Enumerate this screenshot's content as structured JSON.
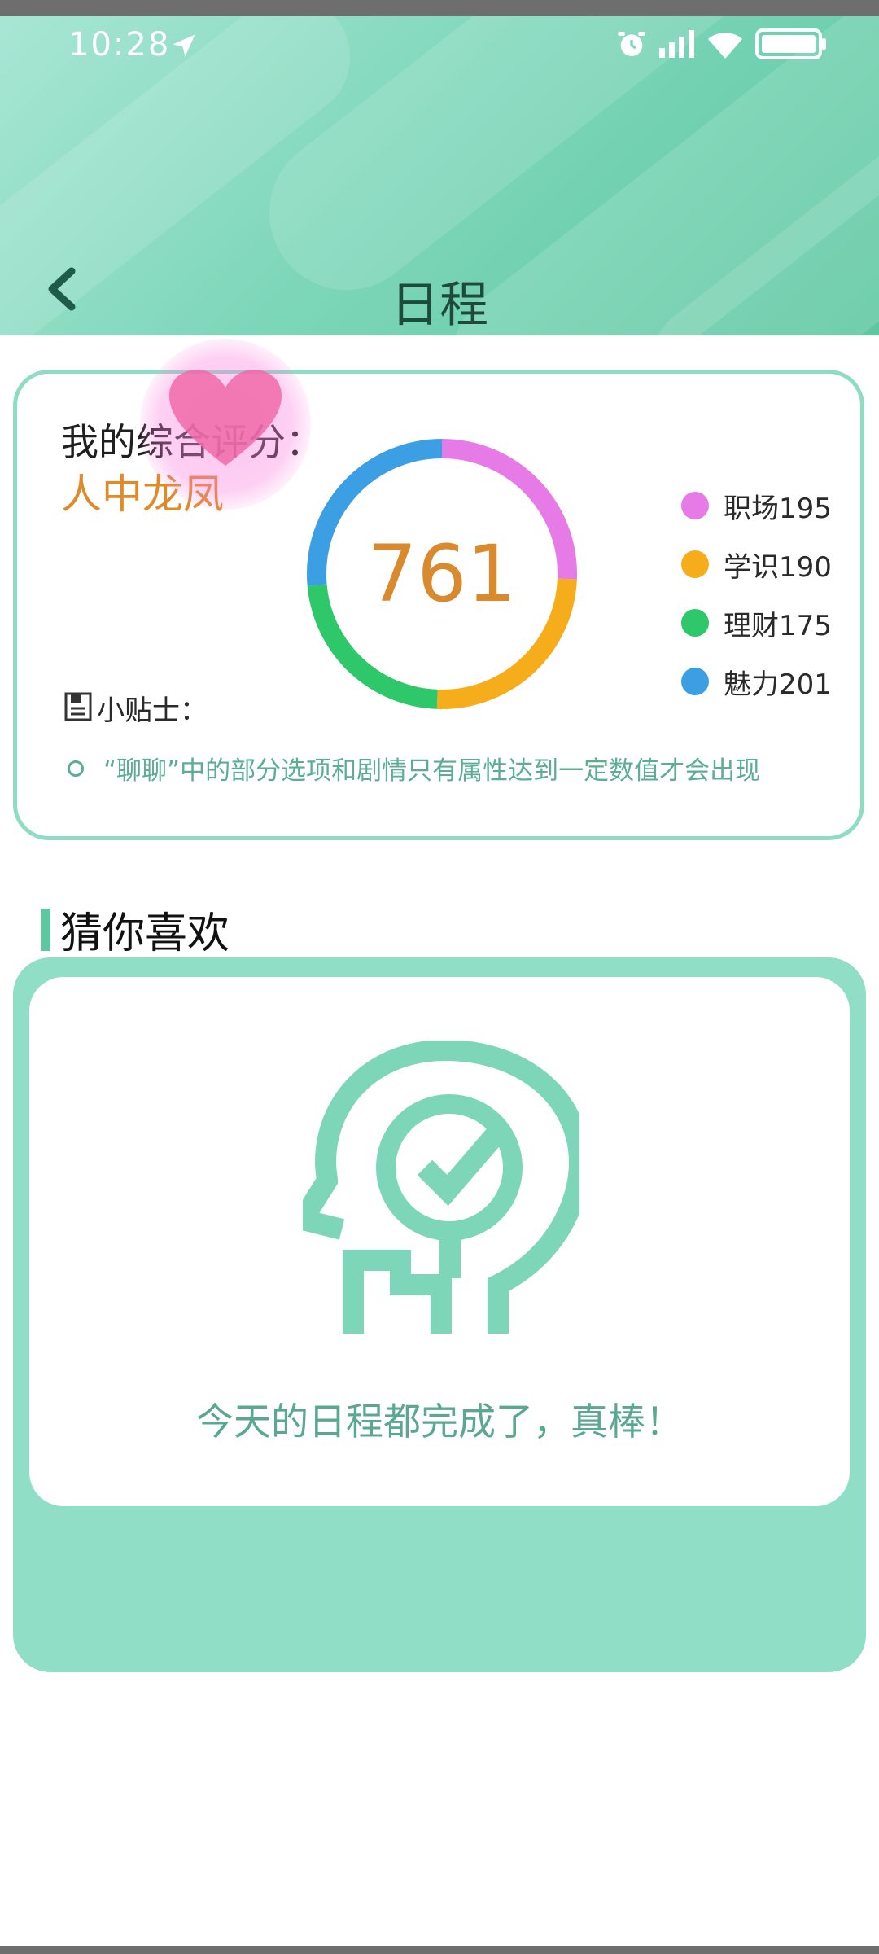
{
  "status_bar": {
    "time": "10:28"
  },
  "header": {
    "title": "日程"
  },
  "score_card": {
    "label": "我的综合评分：",
    "rank": "人中龙凤",
    "score": "761",
    "legend": [
      {
        "label": "职场195",
        "color": "#e67be8"
      },
      {
        "label": "学识190",
        "color": "#f5ad1b"
      },
      {
        "label": "理财175",
        "color": "#2ec86a"
      },
      {
        "label": "魅力201",
        "color": "#3d9fe3"
      }
    ],
    "donut_values": [
      195,
      190,
      175,
      201
    ],
    "tips_label": "小贴士：",
    "tip": "“聊聊”中的部分选项和剧情只有属性达到一定数值才会出现"
  },
  "recommend": {
    "title": "猜你喜欢",
    "message": "今天的日程都完成了，真棒！"
  },
  "colors": {
    "accent": "#5cc7a1",
    "panel": "#8fdec5",
    "rank": "#e08b2a"
  }
}
